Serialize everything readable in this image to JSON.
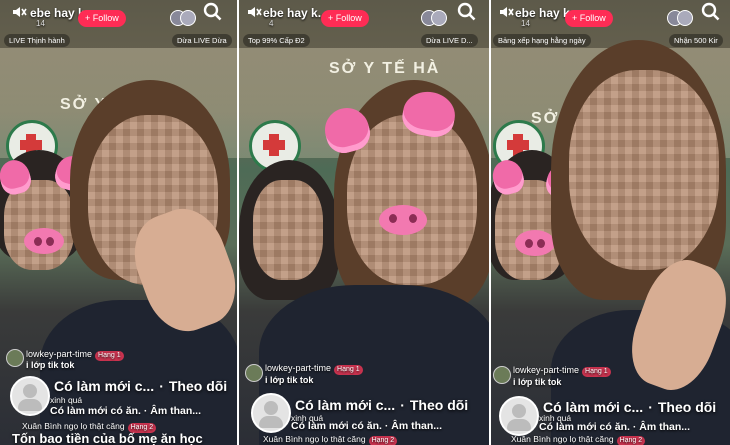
{
  "panels": [
    {
      "header": {
        "title": "ebe hay k...",
        "sub_count": "14",
        "follow": "+ Follow",
        "pill_left": "LIVE Thịnh hành",
        "pill_right": "Dừa LIVE Dừa"
      },
      "comment": {
        "user": "lowkey-part-time",
        "badge": "Hạng 1",
        "text": "i lớp tik tok"
      },
      "song": {
        "title": "Có làm mới c...",
        "follow": "Theo dõi"
      },
      "sub_user": "xinh quá",
      "line2": "Có làm mới có ăn. · Âm than...",
      "small_user": "Xuân Bình ngọ lọ thật căng",
      "small_badge": "Hạng 2",
      "caption": "Tốn bao tiền của bố mẹ ăn học"
    },
    {
      "header": {
        "title": "ebe hay k...",
        "sub_count": "4",
        "follow": "+ Follow",
        "pill_left": "Top 99% Cấp Đ2",
        "pill_right": "Dừa LIVE D..."
      },
      "comment": {
        "user": "lowkey-part-time",
        "badge": "Hạng 1",
        "text": "i lớp tik tok"
      },
      "song": {
        "title": "Có làm mới c...",
        "follow": "Theo dõi"
      },
      "sub_user": "xinh quá",
      "line2": "Có làm mới có ăn. · Âm than...",
      "small_user": "Xuân Bình ngọ lọ thật căng",
      "small_badge": "Hạng 2"
    },
    {
      "header": {
        "title": "ebe hay k...",
        "sub_count": "14",
        "follow": "+ Follow",
        "pill_left": "Bảng xếp hạng hằng ngày",
        "pill_right": "Nhận 500 Kir"
      },
      "comment": {
        "user": "lowkey-part-time",
        "badge": "Hạng 1",
        "text": "i lớp tik tok"
      },
      "song": {
        "title": "Có làm mới c...",
        "follow": "Theo dõi"
      },
      "sub_user": "xinh quá",
      "line2": "Có làm mới có ăn. · Âm than...",
      "small_user": "Xuân Bình ngọ lọ thật căng",
      "small_badge": "Hạng 2"
    }
  ],
  "sign_text": "SỞ Y TẾ HÀ",
  "icons": {
    "mute": "mute-icon",
    "search": "search-icon",
    "music": "music-note-icon",
    "emoji": "emoji-icon"
  },
  "colors": {
    "follow": "#fe2c55",
    "badge": "#c9334f"
  }
}
